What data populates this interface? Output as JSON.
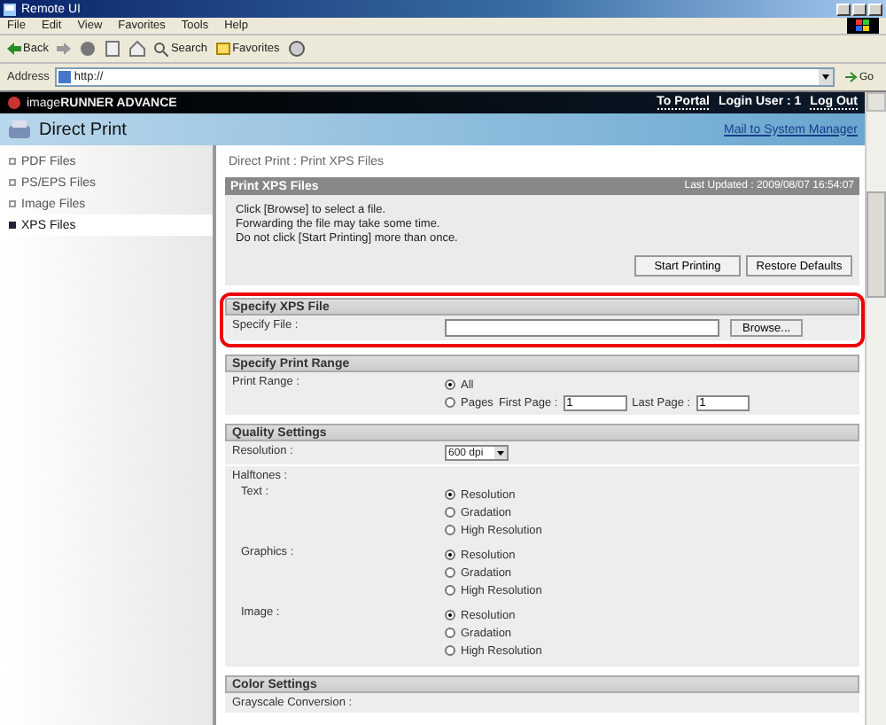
{
  "window": {
    "title": "Remote UI"
  },
  "menu": [
    "File",
    "Edit",
    "View",
    "Favorites",
    "Tools",
    "Help"
  ],
  "toolbar": {
    "back": "Back",
    "search": "Search",
    "favorites": "Favorites"
  },
  "address": {
    "label": "Address",
    "value": "http://",
    "go": "Go"
  },
  "header": {
    "brand": "image**RUNNER ADVANCE**",
    "links": [
      {
        "kind": "link",
        "text": "To Portal"
      },
      {
        "kind": "text",
        "text": "Login User : 1"
      },
      {
        "kind": "link",
        "text": "Log Out"
      }
    ]
  },
  "page_title": "Direct Print",
  "mail_link": "Mail to System Manager",
  "sidebar": {
    "items": [
      {
        "label": "PDF Files",
        "selected": false
      },
      {
        "label": "PS/EPS Files",
        "selected": false
      },
      {
        "label": "Image Files",
        "selected": false
      },
      {
        "label": "XPS Files",
        "selected": true
      }
    ]
  },
  "breadcrumb": "Direct Print : Print XPS Files",
  "panel": {
    "title": "Print XPS Files",
    "last_updated": "Last Updated : 2009/08/07 16:54:07",
    "notes": [
      "Click [Browse] to select a file.",
      "Forwarding the file may take some time.",
      "Do not click [Start Printing] more than once."
    ],
    "buttons": [
      "Start Printing",
      "Restore Defaults"
    ]
  },
  "sections": [
    {
      "title": "Specify XPS File",
      "highlighted": true,
      "rows": [
        {
          "kind": "file",
          "label": "Specify File :",
          "button": "Browse..."
        }
      ]
    },
    {
      "title": "Specify Print Range",
      "highlighted": false,
      "rows": [
        {
          "kind": "range",
          "label": "Print Range :",
          "options": [
            {
              "label": "All",
              "selected": true
            },
            {
              "label": "Pages",
              "selected": false
            }
          ],
          "first_label": "First Page :",
          "first_value": "1",
          "last_label": "Last Page :",
          "last_value": "1"
        }
      ]
    },
    {
      "title": "Quality Settings",
      "highlighted": false,
      "rows": [
        {
          "kind": "select",
          "label": "Resolution :",
          "value": "600 dpi"
        },
        {
          "kind": "group",
          "label": "Halftones :",
          "children": [
            {
              "kind": "radios",
              "label": "Text :",
              "options": [
                {
                  "label": "Resolution",
                  "selected": true
                },
                {
                  "label": "Gradation",
                  "selected": false
                },
                {
                  "label": "High Resolution",
                  "selected": false
                }
              ]
            },
            {
              "kind": "radios",
              "label": "Graphics :",
              "options": [
                {
                  "label": "Resolution",
                  "selected": true
                },
                {
                  "label": "Gradation",
                  "selected": false
                },
                {
                  "label": "High Resolution",
                  "selected": false
                }
              ]
            },
            {
              "kind": "radios",
              "label": "Image :",
              "options": [
                {
                  "label": "Resolution",
                  "selected": true
                },
                {
                  "label": "Gradation",
                  "selected": false
                },
                {
                  "label": "High Resolution",
                  "selected": false
                }
              ]
            }
          ]
        }
      ]
    },
    {
      "title": "Color Settings",
      "highlighted": false,
      "rows": [
        {
          "kind": "group",
          "label": "Grayscale Conversion :",
          "children": []
        }
      ]
    }
  ]
}
